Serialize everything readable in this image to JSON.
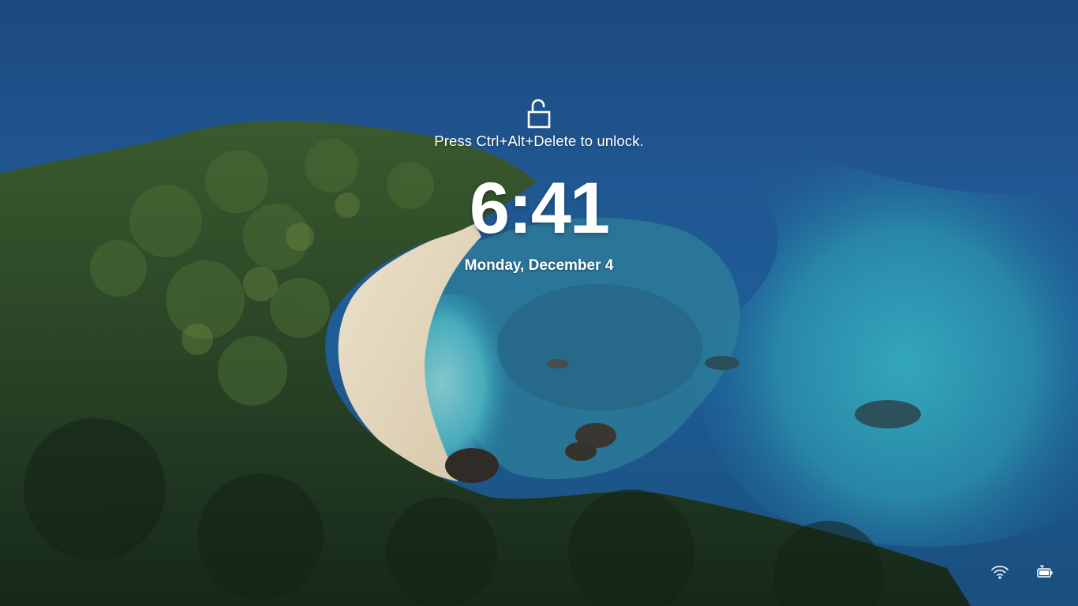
{
  "lock_screen": {
    "unlock_hint": "Press Ctrl+Alt+Delete to unlock.",
    "time": "6:41",
    "date": "Monday, December 4"
  },
  "icons": {
    "lock": "unlocked-padlock-icon",
    "network": "wifi-icon",
    "power": "battery-charging-icon"
  },
  "colors": {
    "text": "#ffffff",
    "deep_ocean": "#1d497f",
    "lagoon": "#2a9bb0",
    "forest": "#1f3a26",
    "sand": "#e3d6bd"
  }
}
